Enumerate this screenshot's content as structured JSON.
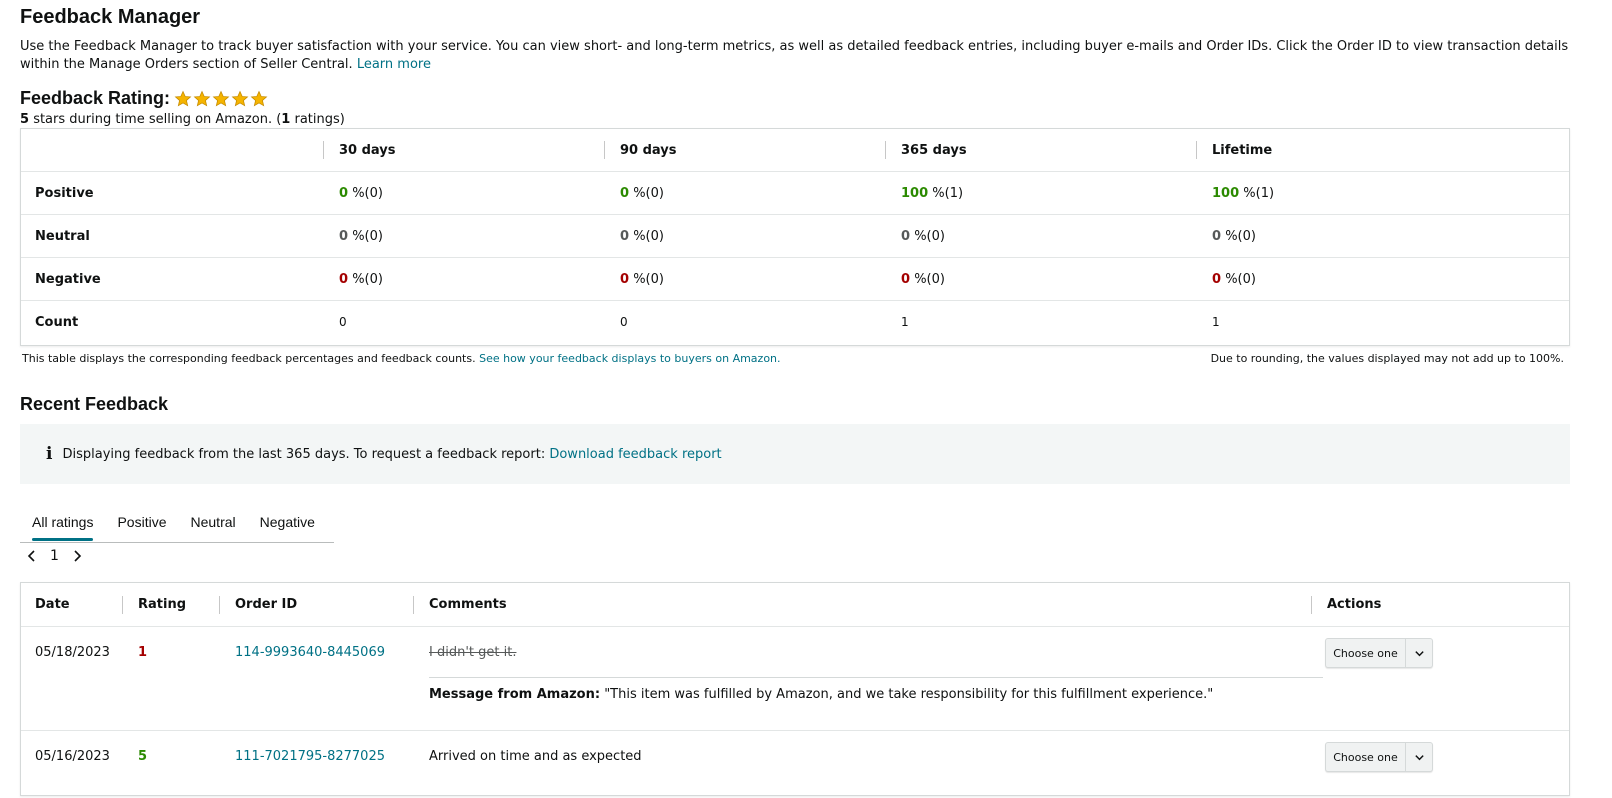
{
  "page": {
    "title": "Feedback Manager",
    "intro": "Use the Feedback Manager to track buyer satisfaction with your service. You can view short- and long-term metrics, as well as detailed feedback entries, including buyer e-mails and Order IDs. Click the Order ID to view transaction details within the Manage Orders section of Seller Central.",
    "learn_more": "Learn more"
  },
  "rating": {
    "label": "Feedback Rating:",
    "stars": 5,
    "star_color": "#f5b400",
    "summary_stars": "5",
    "summary_mid": "stars during time selling on Amazon. (",
    "summary_count": "1",
    "summary_end": "ratings)"
  },
  "metrics": {
    "columns": [
      "30 days",
      "90 days",
      "365 days",
      "Lifetime"
    ],
    "rows": [
      {
        "label": "Positive",
        "cells": [
          {
            "pct": "0",
            "rest": "%(0)"
          },
          {
            "pct": "0",
            "rest": "%(0)"
          },
          {
            "pct": "100",
            "rest": "%(1)"
          },
          {
            "pct": "100",
            "rest": "%(1)"
          }
        ]
      },
      {
        "label": "Neutral",
        "cells": [
          {
            "pct": "0",
            "rest": "%(0)"
          },
          {
            "pct": "0",
            "rest": "%(0)"
          },
          {
            "pct": "0",
            "rest": "%(0)"
          },
          {
            "pct": "0",
            "rest": "%(0)"
          }
        ]
      },
      {
        "label": "Negative",
        "cells": [
          {
            "pct": "0",
            "rest": "%(0)"
          },
          {
            "pct": "0",
            "rest": "%(0)"
          },
          {
            "pct": "0",
            "rest": "%(0)"
          },
          {
            "pct": "0",
            "rest": "%(0)"
          }
        ]
      },
      {
        "label": "Count",
        "cells": [
          "0",
          "0",
          "1",
          "1"
        ]
      }
    ],
    "colors": {
      "positive": "#2b8a00",
      "neutral": "#565959",
      "negative": "#a40000"
    },
    "footnote_text": "This table displays the corresponding feedback percentages and feedback counts.",
    "footnote_link": "See how your feedback displays to buyers on Amazon.",
    "rounding_note": "Due to rounding, the values displayed may not add up to 100%."
  },
  "recent": {
    "title": "Recent Feedback",
    "info_icon": "i",
    "info_text": "Displaying feedback from the last 365 days. To request a feedback report:",
    "info_link": "Download feedback report",
    "tabs": [
      "All ratings",
      "Positive",
      "Neutral",
      "Negative"
    ],
    "active_tab": "All ratings",
    "page": "1",
    "columns": [
      "Date",
      "Rating",
      "Order ID",
      "Comments",
      "Actions"
    ],
    "rows": [
      {
        "date": "05/18/2023",
        "rating": "1",
        "order_id": "114-9993640-8445069",
        "comment": "I didn't get it.",
        "message_label": "Message from Amazon:",
        "message": "\"This item was fulfilled by Amazon, and we take responsibility for this fulfillment experience.\"",
        "action": "Choose one"
      },
      {
        "date": "05/16/2023",
        "rating": "5",
        "order_id": "111-7021795-8277025",
        "comment": "Arrived on time and as expected",
        "action": "Choose one"
      }
    ]
  }
}
